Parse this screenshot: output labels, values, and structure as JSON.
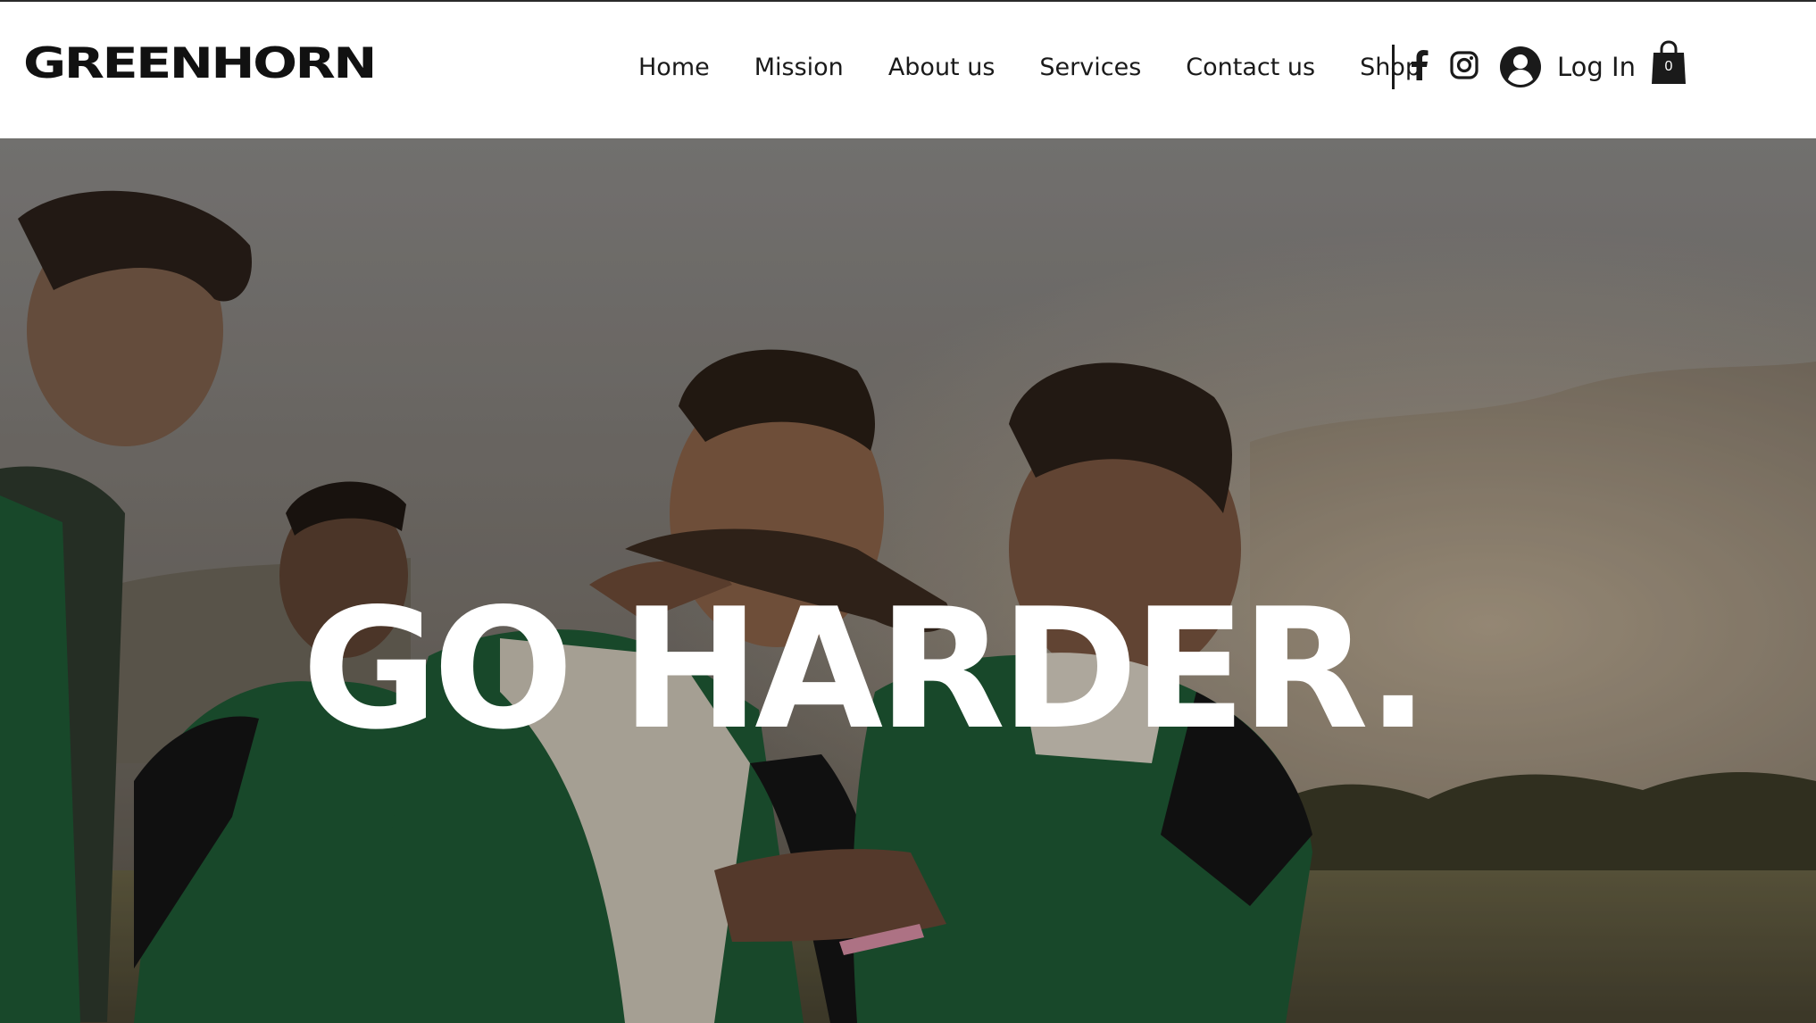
{
  "brand": {
    "name": "GREENHORN"
  },
  "nav": {
    "items": [
      {
        "label": "Home"
      },
      {
        "label": "Mission"
      },
      {
        "label": "About us"
      },
      {
        "label": "Services"
      },
      {
        "label": "Contact us"
      },
      {
        "label": "Shop"
      }
    ]
  },
  "social": {
    "icons": [
      "facebook-icon",
      "instagram-icon"
    ]
  },
  "account": {
    "login_label": "Log In"
  },
  "cart": {
    "count": "0"
  },
  "hero": {
    "headline": "GO HARDER.",
    "image": "rugby-players-celebrating-photo"
  },
  "colors": {
    "header_bg": "#ffffff",
    "text": "#1a1a1a",
    "jersey_green": "#1f5a35",
    "headline": "#ffffff"
  }
}
